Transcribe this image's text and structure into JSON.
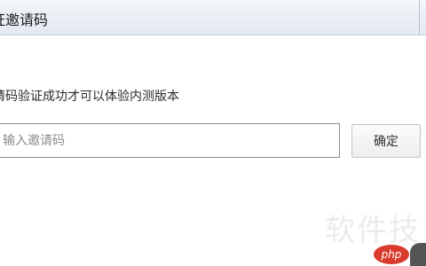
{
  "window": {
    "title": "证邀请码"
  },
  "form": {
    "instruction": "请码验证成功才可以体验内测版本",
    "code_input": {
      "value": "",
      "placeholder": "输入邀请码"
    },
    "confirm_label": "确定"
  },
  "watermark": {
    "text": "软件技",
    "logo_text": "php"
  }
}
